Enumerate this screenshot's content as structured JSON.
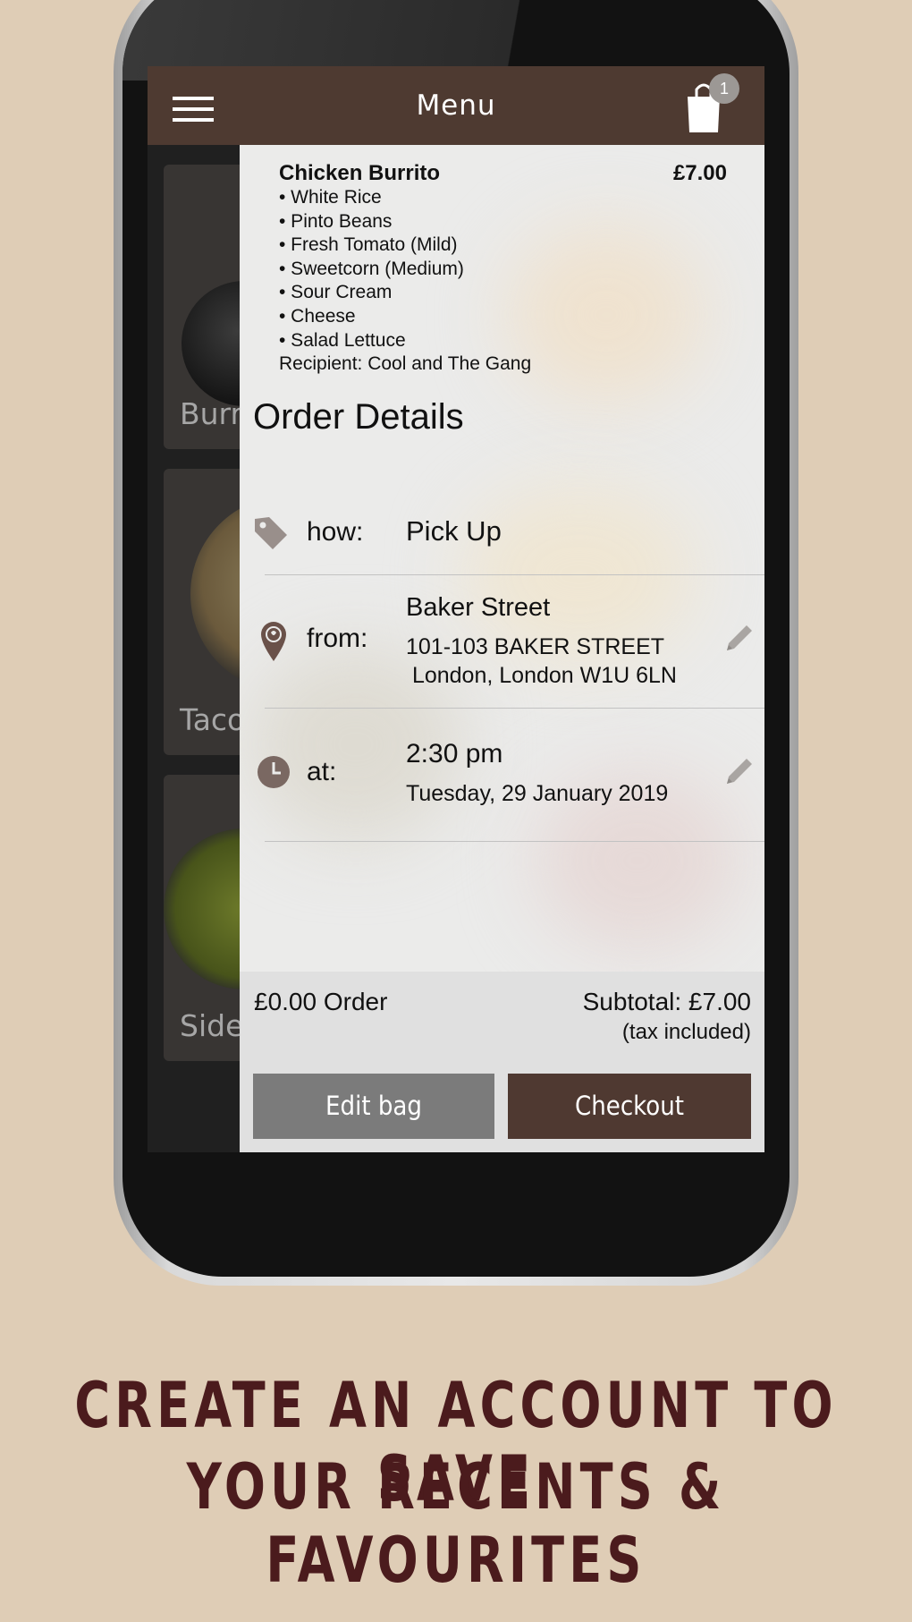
{
  "appbar": {
    "title": "Menu",
    "bag_count": "1"
  },
  "menu_cards": [
    "Burr",
    "Taco",
    "Side"
  ],
  "order_item": {
    "name": "Chicken Burrito",
    "price": "£7.00",
    "options": [
      "• White Rice",
      "• Pinto Beans",
      "• Fresh Tomato (Mild)",
      "• Sweetcorn (Medium)",
      "• Sour Cream",
      "• Cheese",
      "• Salad Lettuce"
    ],
    "recipient": "Recipient: Cool and The Gang"
  },
  "order_details": {
    "title": "Order Details",
    "how": {
      "label": "how:",
      "value": "Pick Up"
    },
    "from": {
      "label": "from:",
      "name": "Baker Street",
      "address1": "101-103 BAKER STREET",
      "address2": " London, London W1U 6LN"
    },
    "at": {
      "label": "at:",
      "time": "2:30 pm",
      "date": "Tuesday, 29 January 2019"
    }
  },
  "footer": {
    "order": "£0.00 Order",
    "subtotal": "Subtotal: £7.00",
    "tax": "(tax included)",
    "edit_label": "Edit bag",
    "checkout_label": "Checkout"
  },
  "promo": {
    "line1": "CREATE AN ACCOUNT TO SAVE",
    "line2": "YOUR RECENTS & FAVOURITES"
  },
  "colors": {
    "brand_brown": "#4e3a31",
    "promo_text": "#4b1b1d",
    "background": "#dfcdb6",
    "icon_brown": "#8a7369"
  },
  "icons": [
    "menu-icon",
    "shopping-bag-icon",
    "tag-icon",
    "location-pin-icon",
    "clock-icon",
    "pencil-icon"
  ]
}
